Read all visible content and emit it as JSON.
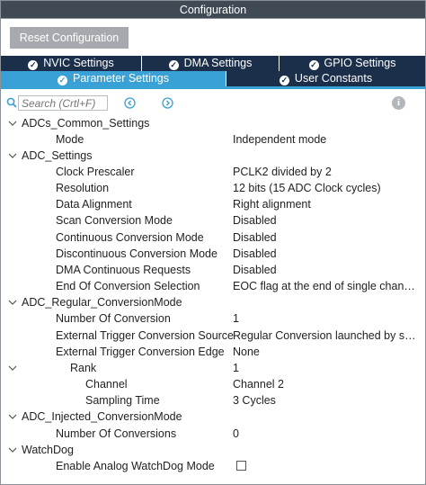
{
  "window": {
    "title": "Configuration"
  },
  "toolbar": {
    "reset_label": "Reset Configuration"
  },
  "tabs": {
    "row1": [
      {
        "label": "NVIC Settings"
      },
      {
        "label": "DMA Settings"
      },
      {
        "label": "GPIO Settings"
      }
    ],
    "row2": [
      {
        "label": "Parameter Settings",
        "active": true
      },
      {
        "label": "User Constants"
      }
    ]
  },
  "search": {
    "placeholder": "Search (Crtl+F)",
    "value": ""
  },
  "icons": {
    "check": "check-circle-icon",
    "search": "search-icon",
    "prev": "arrow-left-circle-icon",
    "next": "arrow-right-circle-icon",
    "info": "info-icon",
    "info_glyph": "i",
    "expand": "chevron-down-icon"
  },
  "colors": {
    "accent": "#3aa1d6",
    "tab_dark": "#1b2f4a",
    "title_bar": "#3f4a55",
    "button": "#a6aaae"
  },
  "params": {
    "adc_common": {
      "label": "ADCs_Common_Settings",
      "mode_name": "Mode",
      "mode_value": "Independent mode"
    },
    "adc_settings": {
      "label": "ADC_Settings",
      "clock_name": "Clock Prescaler",
      "clock_value": "PCLK2 divided by 2",
      "resolution_name": "Resolution",
      "resolution_value": "12 bits (15 ADC Clock cycles)",
      "alignment_name": "Data Alignment",
      "alignment_value": "Right alignment",
      "scan_name": "Scan Conversion Mode",
      "scan_value": "Disabled",
      "continuous_name": "Continuous Conversion Mode",
      "continuous_value": "Disabled",
      "discontinuous_name": "Discontinuous Conversion Mode",
      "discontinuous_value": "Disabled",
      "dma_name": "DMA Continuous Requests",
      "dma_value": "Disabled",
      "eoc_name": "End Of Conversion Selection",
      "eoc_value": "EOC flag at the end of single channel conversion"
    },
    "regular": {
      "label": "ADC_Regular_ConversionMode",
      "num_name": "Number Of Conversion",
      "num_value": "1",
      "trigger_name": "External Trigger Conversion Source",
      "trigger_value": "Regular Conversion launched by software",
      "edge_name": "External Trigger Conversion Edge",
      "edge_value": "None",
      "rank_name": "Rank",
      "rank_value": "1",
      "channel_name": "Channel",
      "channel_value": "Channel 2",
      "sampling_name": "Sampling Time",
      "sampling_value": "3 Cycles"
    },
    "injected": {
      "label": "ADC_Injected_ConversionMode",
      "num_name": "Number Of Conversions",
      "num_value": "0"
    },
    "watchdog": {
      "label": "WatchDog",
      "enable_name": "Enable Analog WatchDog Mode",
      "enable_checked": false
    }
  }
}
